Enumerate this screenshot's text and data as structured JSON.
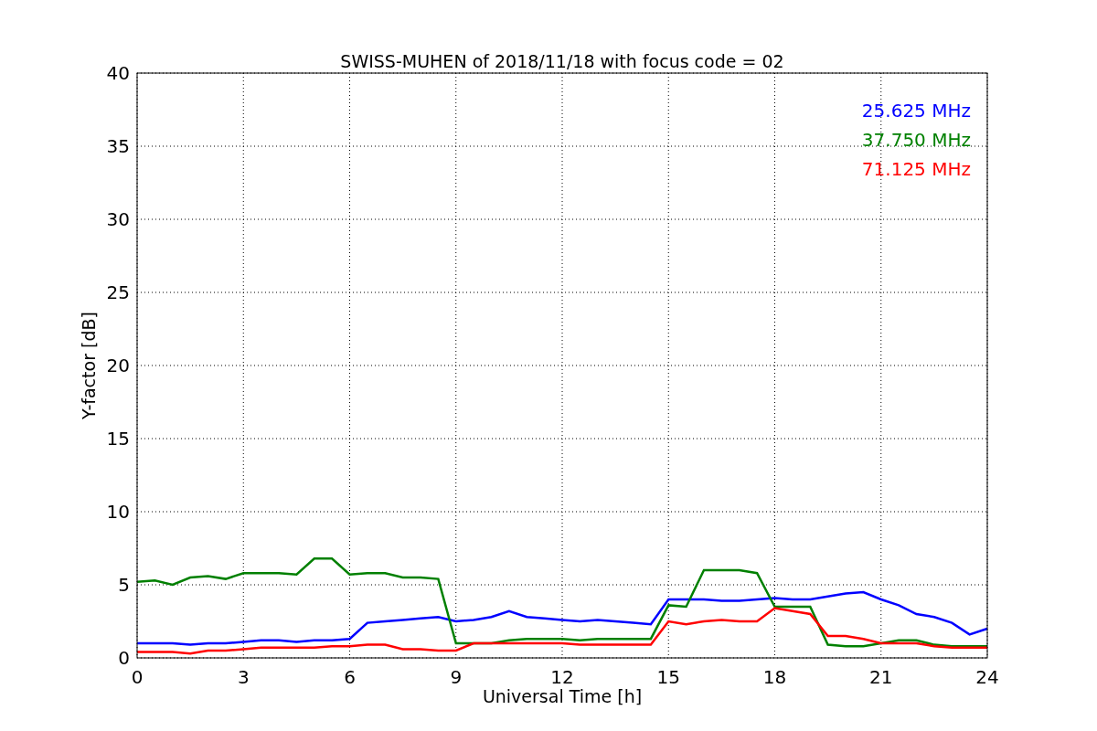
{
  "chart_data": {
    "type": "line",
    "title": "SWISS-MUHEN of 2018/11/18 with focus code = 02",
    "xlabel": "Universal Time [h]",
    "ylabel": "Y-factor [dB]",
    "x": [
      0,
      0.5,
      1,
      1.5,
      2,
      2.5,
      3,
      3.5,
      4,
      4.5,
      5,
      5.5,
      6,
      6.5,
      7,
      7.5,
      8,
      8.5,
      9,
      9.5,
      10,
      10.5,
      11,
      11.5,
      12,
      12.5,
      13,
      13.5,
      14,
      14.5,
      15,
      15.5,
      16,
      16.5,
      17,
      17.5,
      18,
      18.5,
      19,
      19.5,
      20,
      20.5,
      21,
      21.5,
      22,
      22.5,
      23,
      23.5,
      24
    ],
    "series": [
      {
        "name": "25.625 MHz",
        "color": "#0000ff",
        "values": [
          1,
          1,
          1,
          0.9,
          1,
          1,
          1.1,
          1.2,
          1.2,
          1.1,
          1.2,
          1.2,
          1.3,
          2.4,
          2.5,
          2.6,
          2.7,
          2.8,
          2.5,
          2.6,
          2.8,
          3.2,
          2.8,
          2.7,
          2.6,
          2.5,
          2.6,
          2.5,
          2.4,
          2.3,
          4,
          4,
          4,
          3.9,
          3.9,
          4,
          4.1,
          4,
          4,
          4.2,
          4.4,
          4.5,
          4,
          3.6,
          3,
          2.8,
          2.4,
          1.6,
          2
        ]
      },
      {
        "name": "37.750 MHz",
        "color": "#008000",
        "values": [
          5.2,
          5.3,
          5,
          5.5,
          5.6,
          5.4,
          5.8,
          5.8,
          5.8,
          5.7,
          6.8,
          6.8,
          5.7,
          5.8,
          5.8,
          5.5,
          5.5,
          5.4,
          1,
          1,
          1,
          1.2,
          1.3,
          1.3,
          1.3,
          1.2,
          1.3,
          1.3,
          1.3,
          1.3,
          3.6,
          3.5,
          6,
          6,
          6,
          5.8,
          3.5,
          3.5,
          3.5,
          0.9,
          0.8,
          0.8,
          1,
          1.2,
          1.2,
          0.9,
          0.8,
          0.8,
          0.8
        ]
      },
      {
        "name": "71.125 MHz",
        "color": "#ff0000",
        "values": [
          0.4,
          0.4,
          0.4,
          0.3,
          0.5,
          0.5,
          0.6,
          0.7,
          0.7,
          0.7,
          0.7,
          0.8,
          0.8,
          0.9,
          0.9,
          0.6,
          0.6,
          0.5,
          0.5,
          1,
          1,
          1,
          1,
          1,
          1,
          0.9,
          0.9,
          0.9,
          0.9,
          0.9,
          2.5,
          2.3,
          2.5,
          2.6,
          2.5,
          2.5,
          3.4,
          3.2,
          3,
          1.5,
          1.5,
          1.3,
          1,
          1,
          1,
          0.8,
          0.7,
          0.7,
          0.7
        ]
      }
    ],
    "grid": true,
    "xlim": [
      0,
      24
    ],
    "ylim": [
      0,
      40
    ],
    "xticks": [
      0,
      3,
      6,
      9,
      12,
      15,
      18,
      21,
      24
    ],
    "yticks": [
      0,
      5,
      10,
      15,
      20,
      25,
      30,
      35,
      40
    ]
  }
}
